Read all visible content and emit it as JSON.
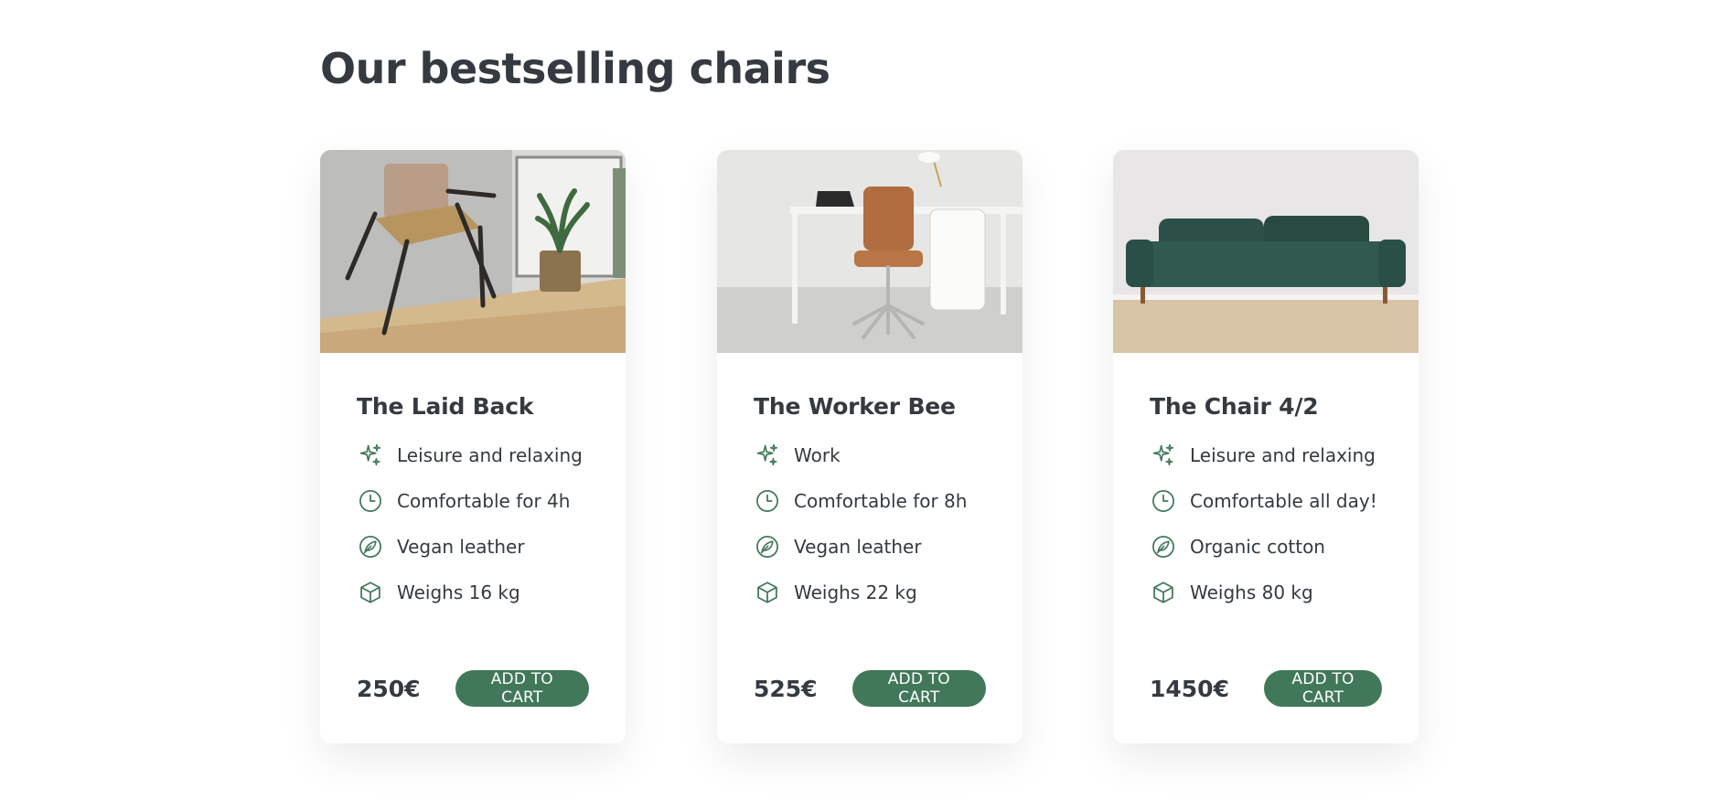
{
  "section": {
    "title": "Our bestselling chairs"
  },
  "colors": {
    "accent": "#41785a",
    "text": "#343a40",
    "background": "#ffffff"
  },
  "icons": [
    "sparkles-icon",
    "clock-icon",
    "leaf-circle-icon",
    "box-cube-icon"
  ],
  "products": [
    {
      "name": "The Laid Back",
      "image": "armchair-photo",
      "features": [
        "Leisure and relaxing",
        "Comfortable for 4h",
        "Vegan leather",
        "Weighs 16 kg"
      ],
      "price": "250€",
      "cta": "ADD TO CART"
    },
    {
      "name": "The Worker Bee",
      "image": "office-chair-photo",
      "features": [
        "Work",
        "Comfortable for 8h",
        "Vegan leather",
        "Weighs 22 kg"
      ],
      "price": "525€",
      "cta": "ADD TO CART"
    },
    {
      "name": "The Chair 4/2",
      "image": "sofa-photo",
      "features": [
        "Leisure and relaxing",
        "Comfortable all day!",
        "Organic cotton",
        "Weighs 80 kg"
      ],
      "price": "1450€",
      "cta": "ADD TO CART"
    }
  ]
}
